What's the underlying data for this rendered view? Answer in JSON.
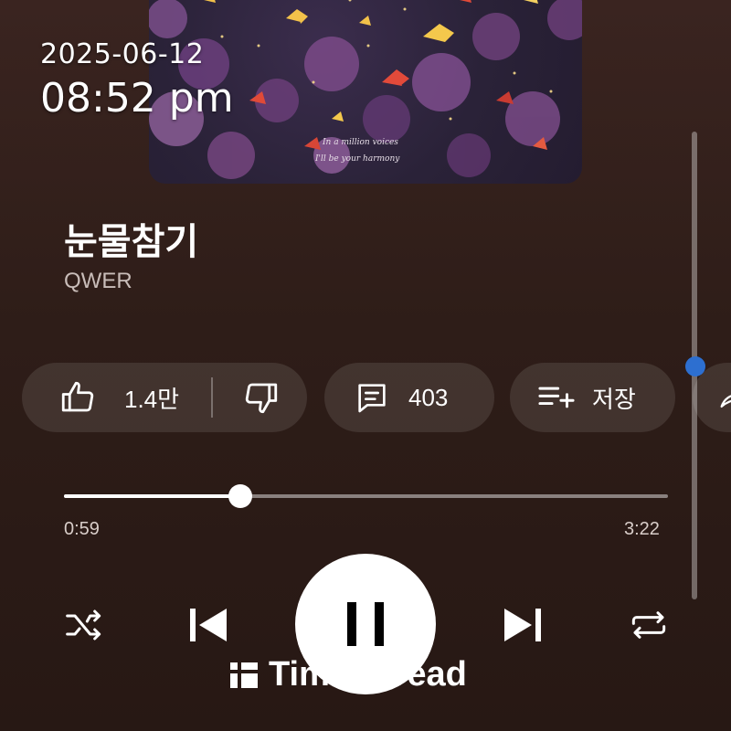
{
  "status": {
    "date": "2025-06-12",
    "time": "08:52 pm"
  },
  "track": {
    "title": "눈물참기",
    "artist": "QWER"
  },
  "album_art": {
    "script_line_1": "In a million voices",
    "script_line_2": "I'll be your harmony"
  },
  "actions": {
    "like_count": "1.4만",
    "comment_count": "403",
    "save_label": "저장"
  },
  "playback": {
    "elapsed": "0:59",
    "total": "3:22",
    "progress_fraction": 0.292
  },
  "watermark": {
    "text": "TimeSpread"
  },
  "colors": {
    "background": "#2e1d18",
    "pill": "rgba(255,255,255,0.10)",
    "accent_scroll": "#2d6fd0"
  },
  "icons": {
    "like": "thumbs-up-icon",
    "dislike": "thumbs-down-icon",
    "comment": "comment-icon",
    "save": "playlist-add-icon",
    "shuffle": "shuffle-icon",
    "previous": "skip-previous-icon",
    "pause": "pause-icon",
    "next": "skip-next-icon",
    "repeat": "repeat-icon"
  }
}
